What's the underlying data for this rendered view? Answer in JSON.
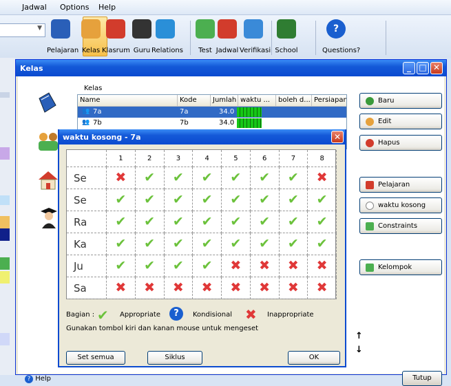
{
  "menu": [
    "Jadwal",
    "Options",
    "Help"
  ],
  "toolbar": {
    "buttons": [
      {
        "label": "Pelajaran",
        "icon": "book-icon",
        "color": "#2a5fb8"
      },
      {
        "label": "Kelas",
        "icon": "students-icon",
        "color": "#e6a13c"
      },
      {
        "label": "Klasrum",
        "icon": "house-icon",
        "color": "#d23c2c"
      },
      {
        "label": "Guru",
        "icon": "teacher-icon",
        "color": "#333333"
      },
      {
        "label": "Relations",
        "icon": "puzzle-icon",
        "color": "#2a8fd8"
      },
      {
        "label": "Test",
        "icon": "test-icon",
        "color": "#4caf50"
      },
      {
        "label": "Jadwal",
        "icon": "jadwal-icon",
        "color": "#d23c2c"
      },
      {
        "label": "Verifikasi",
        "icon": "verify-icon",
        "color": "#3a8ad8"
      },
      {
        "label": "School",
        "icon": "school-board-icon",
        "color": "#2f7d32"
      },
      {
        "label": "Questions?",
        "icon": "question-icon",
        "color": "#1a5fcf"
      }
    ]
  },
  "kelas_window": {
    "title": "Kelas",
    "group_label": "Kelas",
    "columns": [
      "Name",
      "Kode",
      "Jumlah",
      "waktu ...",
      "boleh d...",
      "Persiapan"
    ],
    "rows": [
      {
        "name": "7a",
        "kode": "7a",
        "jumlah": "34.0"
      },
      {
        "name": "7b",
        "kode": "7b",
        "jumlah": "34.0"
      }
    ],
    "buttons_top": [
      {
        "label": "Baru",
        "icon": "add-icon",
        "color": "#3a9a3a"
      },
      {
        "label": "Edit",
        "icon": "edit-students-icon",
        "color": "#e6a13c"
      },
      {
        "label": "Hapus",
        "icon": "delete-icon",
        "color": "#d23c2c"
      }
    ],
    "buttons_bottom": [
      {
        "label": "Pelajaran",
        "icon": "book-small-icon",
        "color": "#d23c2c"
      },
      {
        "label": "waktu kosong",
        "icon": "clock-icon",
        "color": "#888888"
      },
      {
        "label": "Constraints",
        "icon": "constraints-icon",
        "color": "#4caf50"
      }
    ],
    "kelompok_label": "Kelompok",
    "help_label": "Help",
    "close_label": "Tutup"
  },
  "dialog": {
    "title": "waktu kosong - 7a",
    "periods": [
      "1",
      "2",
      "3",
      "4",
      "5",
      "6",
      "7",
      "8"
    ],
    "days": [
      {
        "label": "Se",
        "slots": [
          "no",
          "ok",
          "ok",
          "ok",
          "ok",
          "ok",
          "ok",
          "no"
        ]
      },
      {
        "label": "Se",
        "slots": [
          "ok",
          "ok",
          "ok",
          "ok",
          "ok",
          "ok",
          "ok",
          "ok"
        ]
      },
      {
        "label": "Ra",
        "slots": [
          "ok",
          "ok",
          "ok",
          "ok",
          "ok",
          "ok",
          "ok",
          "ok"
        ]
      },
      {
        "label": "Ka",
        "slots": [
          "ok",
          "ok",
          "ok",
          "ok",
          "ok",
          "ok",
          "ok",
          "ok"
        ]
      },
      {
        "label": "Ju",
        "slots": [
          "ok",
          "ok",
          "ok",
          "ok",
          "no",
          "no",
          "no",
          "no"
        ]
      },
      {
        "label": "Sa",
        "slots": [
          "no",
          "no",
          "no",
          "no",
          "no",
          "no",
          "no",
          "no"
        ]
      }
    ],
    "legend": {
      "prefix": "Bagian :",
      "appropriate": "Appropriate",
      "conditional": "Kondisional",
      "inappropriate": "Inappropriate"
    },
    "hint": "Gunakan tombol kiri dan kanan mouse untuk mengeset",
    "btn_set_all": "Set semua",
    "btn_cycle": "Siklus",
    "btn_ok": "OK"
  }
}
